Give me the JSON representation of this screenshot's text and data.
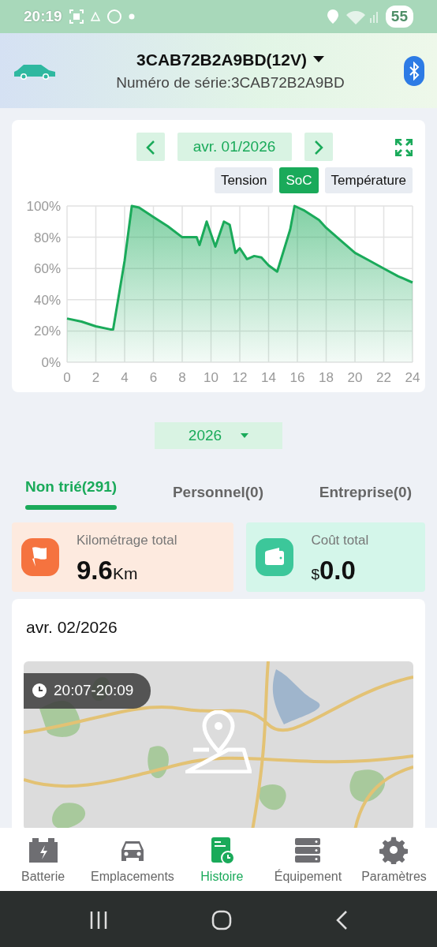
{
  "status_bar": {
    "time": "20:19",
    "battery": "55"
  },
  "header": {
    "title": "3CAB72B2A9BD(12V)",
    "serial": "Numéro de série:3CAB72B2A9BD"
  },
  "chart_card": {
    "date": "avr. 01/2026",
    "series_tabs": [
      {
        "label": "Tension",
        "selected": false
      },
      {
        "label": "SoC",
        "selected": true
      },
      {
        "label": "Température",
        "selected": false
      }
    ],
    "chart_data": {
      "type": "area",
      "x": [
        0,
        1,
        2,
        3,
        3.2,
        4,
        4.5,
        5,
        6,
        7,
        8,
        9,
        9.2,
        9.7,
        10.3,
        10.9,
        11.3,
        11.7,
        12,
        12.5,
        13,
        13.5,
        14,
        14.6,
        15.5,
        15.8,
        16.5,
        17.5,
        18,
        19,
        20,
        21,
        22,
        23,
        24
      ],
      "series": [
        {
          "color": "#1aaa5a",
          "values": [
            28,
            26,
            23,
            21,
            21,
            65,
            100,
            99,
            93,
            87,
            80,
            80,
            75,
            90,
            74,
            90,
            88,
            70,
            73,
            66,
            68,
            67,
            62,
            58,
            85,
            100,
            97,
            91,
            86,
            78,
            70,
            65,
            60,
            55,
            51
          ]
        }
      ],
      "grid": true,
      "xlim": [
        0,
        24
      ],
      "ylim": [
        0,
        100
      ],
      "xticks": [
        0,
        2,
        4,
        6,
        8,
        10,
        12,
        14,
        16,
        18,
        20,
        22,
        24
      ],
      "yticks": [
        {
          "value": 0,
          "label": "0%"
        },
        {
          "value": 20,
          "label": "20%"
        },
        {
          "value": 40,
          "label": "40%"
        },
        {
          "value": 60,
          "label": "60%"
        },
        {
          "value": 80,
          "label": "80%"
        },
        {
          "value": 100,
          "label": "100%"
        }
      ]
    }
  },
  "year_selector": {
    "value": "2026"
  },
  "trip_tabs": [
    {
      "label": "Non trié(291)",
      "selected": true
    },
    {
      "label": "Personnel(0)",
      "selected": false
    },
    {
      "label": "Entreprise(0)",
      "selected": false
    }
  ],
  "stats": [
    {
      "kind": "distance",
      "label": "Kilométrage total",
      "value": "9.6",
      "unit": "Km"
    },
    {
      "kind": "cost",
      "label": "Coût total",
      "value": "0.0",
      "currency": "$"
    }
  ],
  "trip": {
    "date": "avr. 02/2026",
    "time_range": "20:07-20:09"
  },
  "bottom_nav": [
    {
      "kind": "battery",
      "label": "Batterie",
      "selected": false
    },
    {
      "kind": "car",
      "label": "Emplacements",
      "selected": false
    },
    {
      "kind": "history",
      "label": "Histoire",
      "selected": true
    },
    {
      "kind": "equipment",
      "label": "Équipement",
      "selected": false
    },
    {
      "kind": "settings",
      "label": "Paramètres",
      "selected": false
    }
  ]
}
